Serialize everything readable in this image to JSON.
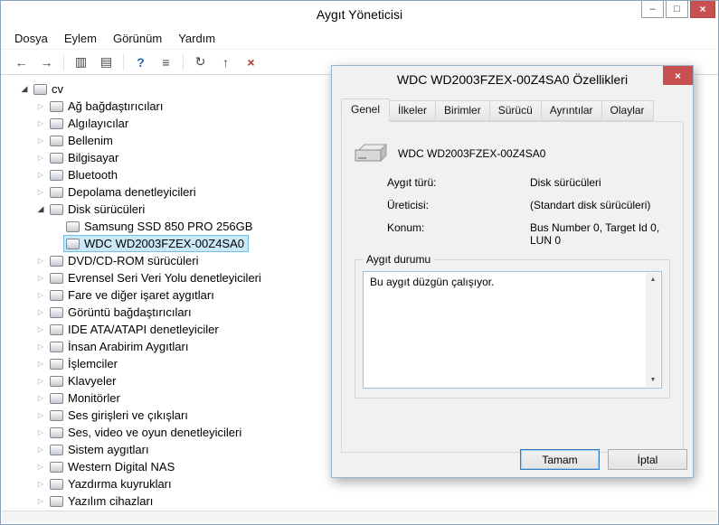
{
  "window": {
    "title": "Aygıt Yöneticisi",
    "controls": {
      "minimize_glyph": "–",
      "maximize_glyph": "□",
      "close_glyph": "×"
    }
  },
  "icons": {
    "collapsed": "▷",
    "expanded": "◢",
    "scroll_up": "▲",
    "scroll_down": "▼"
  },
  "menu": {
    "items": [
      {
        "id": "dosya",
        "label": "Dosya"
      },
      {
        "id": "eylem",
        "label": "Eylem"
      },
      {
        "id": "gorunum",
        "label": "Görünüm"
      },
      {
        "id": "yardim",
        "label": "Yardım"
      }
    ]
  },
  "toolbar": {
    "items": [
      {
        "name": "back-button",
        "icon": "back-icon",
        "glyph": "←"
      },
      {
        "name": "forward-button",
        "icon": "forward-icon",
        "glyph": "→"
      },
      {
        "type": "separator"
      },
      {
        "name": "console-tree-button",
        "icon": "console-tree-icon",
        "glyph": "▥"
      },
      {
        "name": "properties-button",
        "icon": "properties-icon",
        "glyph": "▤"
      },
      {
        "type": "separator"
      },
      {
        "name": "help-button",
        "icon": "help-icon",
        "glyph": "?",
        "class": "tb-help"
      },
      {
        "name": "device-list-button",
        "icon": "list-icon",
        "glyph": "≡"
      },
      {
        "type": "separator"
      },
      {
        "name": "scan-hardware-button",
        "icon": "scan-hardware-icon",
        "glyph": "↻"
      },
      {
        "name": "update-driver-button",
        "icon": "update-driver-icon",
        "glyph": "↑"
      },
      {
        "name": "uninstall-device-button",
        "icon": "uninstall-icon",
        "glyph": "×",
        "class": "tb-uninstall"
      }
    ]
  },
  "tree": {
    "items": [
      {
        "id": "cv",
        "label": "cv",
        "level": 0,
        "arrow": "expanded",
        "icon": "computer"
      },
      {
        "id": "ag-bagdastiricilari",
        "label": "Ağ bağdaştırıcıları",
        "level": 1,
        "arrow": "collapsed",
        "icon": "network-adapter"
      },
      {
        "id": "algilayicilar",
        "label": "Algılayıcılar",
        "level": 1,
        "arrow": "collapsed",
        "icon": "sensor"
      },
      {
        "id": "bellenim",
        "label": "Bellenim",
        "level": 1,
        "arrow": "collapsed",
        "icon": "firmware"
      },
      {
        "id": "bilgisayar",
        "label": "Bilgisayar",
        "level": 1,
        "arrow": "collapsed",
        "icon": "computer"
      },
      {
        "id": "bluetooth",
        "label": "Bluetooth",
        "level": 1,
        "arrow": "collapsed",
        "icon": "bluetooth"
      },
      {
        "id": "depolama-denetleyicileri",
        "label": "Depolama denetleyicileri",
        "level": 1,
        "arrow": "collapsed",
        "icon": "storage-controller"
      },
      {
        "id": "disk-suruculeri",
        "label": "Disk sürücüleri",
        "level": 1,
        "arrow": "expanded",
        "icon": "disk-drive"
      },
      {
        "id": "samsung-ssd-850-pro",
        "label": "Samsung SSD 850 PRO 256GB",
        "level": 2,
        "arrow": "none",
        "icon": "disk-drive"
      },
      {
        "id": "wdc-wd2003fzex",
        "label": "WDC WD2003FZEX-00Z4SA0",
        "level": 2,
        "arrow": "none",
        "icon": "disk-drive",
        "selected": true
      },
      {
        "id": "dvd-cd-rom-suruculeri",
        "label": "DVD/CD-ROM sürücüleri",
        "level": 1,
        "arrow": "collapsed",
        "icon": "dvd-drive"
      },
      {
        "id": "evrensel-seri-veri-yolu",
        "label": "Evrensel Seri Veri Yolu denetleyicileri",
        "level": 1,
        "arrow": "collapsed",
        "icon": "usb-controller"
      },
      {
        "id": "fare-ve-isaret-aygitlari",
        "label": "Fare ve diğer işaret aygıtları",
        "level": 1,
        "arrow": "collapsed",
        "icon": "mouse"
      },
      {
        "id": "goruntu-bagdastiricilari",
        "label": "Görüntü bağdaştırıcıları",
        "level": 1,
        "arrow": "collapsed",
        "icon": "display-adapter"
      },
      {
        "id": "ide-ata-atapi",
        "label": "IDE ATA/ATAPI denetleyiciler",
        "level": 1,
        "arrow": "collapsed",
        "icon": "ide-controller"
      },
      {
        "id": "insan-arabirim-aygitlari",
        "label": "İnsan Arabirim Aygıtları",
        "level": 1,
        "arrow": "collapsed",
        "icon": "hid-device"
      },
      {
        "id": "islemciler",
        "label": "İşlemciler",
        "level": 1,
        "arrow": "collapsed",
        "icon": "processor"
      },
      {
        "id": "klavyeler",
        "label": "Klavyeler",
        "level": 1,
        "arrow": "collapsed",
        "icon": "keyboard"
      },
      {
        "id": "monitorler",
        "label": "Monitörler",
        "level": 1,
        "arrow": "collapsed",
        "icon": "monitor"
      },
      {
        "id": "ses-girisleri-cikislari",
        "label": "Ses girişleri ve çıkışları",
        "level": 1,
        "arrow": "collapsed",
        "icon": "audio-device"
      },
      {
        "id": "ses-video-oyun",
        "label": "Ses, video ve oyun denetleyicileri",
        "level": 1,
        "arrow": "collapsed",
        "icon": "sound-controller"
      },
      {
        "id": "sistem-aygitlari",
        "label": "Sistem aygıtları",
        "level": 1,
        "arrow": "collapsed",
        "icon": "system-device"
      },
      {
        "id": "western-digital-nas",
        "label": "Western Digital NAS",
        "level": 1,
        "arrow": "collapsed",
        "icon": "nas-device"
      },
      {
        "id": "yazdirma-kuyruklari",
        "label": "Yazdırma kuyrukları",
        "level": 1,
        "arrow": "collapsed",
        "icon": "print-queue"
      },
      {
        "id": "yazilim-cihazlari",
        "label": "Yazılım cihazları",
        "level": 1,
        "arrow": "collapsed",
        "icon": "software-device"
      }
    ]
  },
  "dialog": {
    "title": "WDC WD2003FZEX-00Z4SA0 Özellikleri",
    "close_glyph": "×",
    "tabs": [
      {
        "id": "genel",
        "label": "Genel",
        "active": true
      },
      {
        "id": "ilkeler",
        "label": "İlkeler",
        "active": false
      },
      {
        "id": "birimler",
        "label": "Birimler",
        "active": false
      },
      {
        "id": "surucu",
        "label": "Sürücü",
        "active": false
      },
      {
        "id": "ayrintilar",
        "label": "Ayrıntılar",
        "active": false
      },
      {
        "id": "olaylar",
        "label": "Olaylar",
        "active": false
      }
    ],
    "device_name": "WDC WD2003FZEX-00Z4SA0",
    "fields": [
      {
        "label": "Aygıt türü:",
        "value": "Disk sürücüleri"
      },
      {
        "label": "Üreticisi:",
        "value": "(Standart disk sürücüleri)"
      },
      {
        "label": "Konum:",
        "value": "Bus Number 0, Target Id 0, LUN 0"
      }
    ],
    "status_group": {
      "label": "Aygıt durumu",
      "status_text": "Bu aygıt düzgün çalışıyor."
    },
    "buttons": {
      "ok": "Tamam",
      "cancel": "İptal"
    }
  },
  "colors": {
    "selection_bg": "#cbe8f6",
    "selection_border": "#70c0e7",
    "close_button_bg": "#c75050",
    "default_button_border": "#2d7dc0",
    "dialog_bg": "#f1f1f1"
  }
}
